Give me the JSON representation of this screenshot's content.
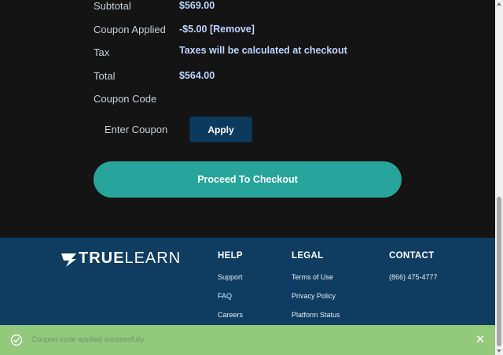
{
  "summary": {
    "subtotal_label": "Subtotal",
    "subtotal_value": "$569.00",
    "coupon_applied_label": "Coupon Applied",
    "coupon_applied_value": "-$5.00",
    "remove_label": "[Remove]",
    "tax_label": "Tax",
    "tax_value": "Taxes will be calculated at checkout",
    "total_label": "Total",
    "total_value": "$564.00",
    "coupon_code_label": "Coupon Code"
  },
  "coupon": {
    "placeholder": "Enter Coupon",
    "apply_label": "Apply"
  },
  "checkout": {
    "label": "Proceed To Checkout"
  },
  "footer": {
    "logo": {
      "part1": "TRUE",
      "part2": "LEARN"
    },
    "help": {
      "title": "HELP",
      "links": [
        "Support",
        "FAQ",
        "Careers"
      ]
    },
    "legal": {
      "title": "LEGAL",
      "links": [
        "Terms of Use",
        "Privacy Policy",
        "Platform Status"
      ]
    },
    "contact": {
      "title": "CONTACT",
      "phone": "(866) 475-4777"
    }
  },
  "toast": {
    "message": "Coupon code applied successfully.",
    "icon": "check-circle-icon",
    "close_icon": "close-icon",
    "color": "#92c97a"
  },
  "colors": {
    "page_bg": "#141414",
    "accent_teal": "#27a59a",
    "apply_blue": "#0b3a5e",
    "footer_blue": "#0f3d61",
    "value_blue": "#bcd3ff"
  }
}
